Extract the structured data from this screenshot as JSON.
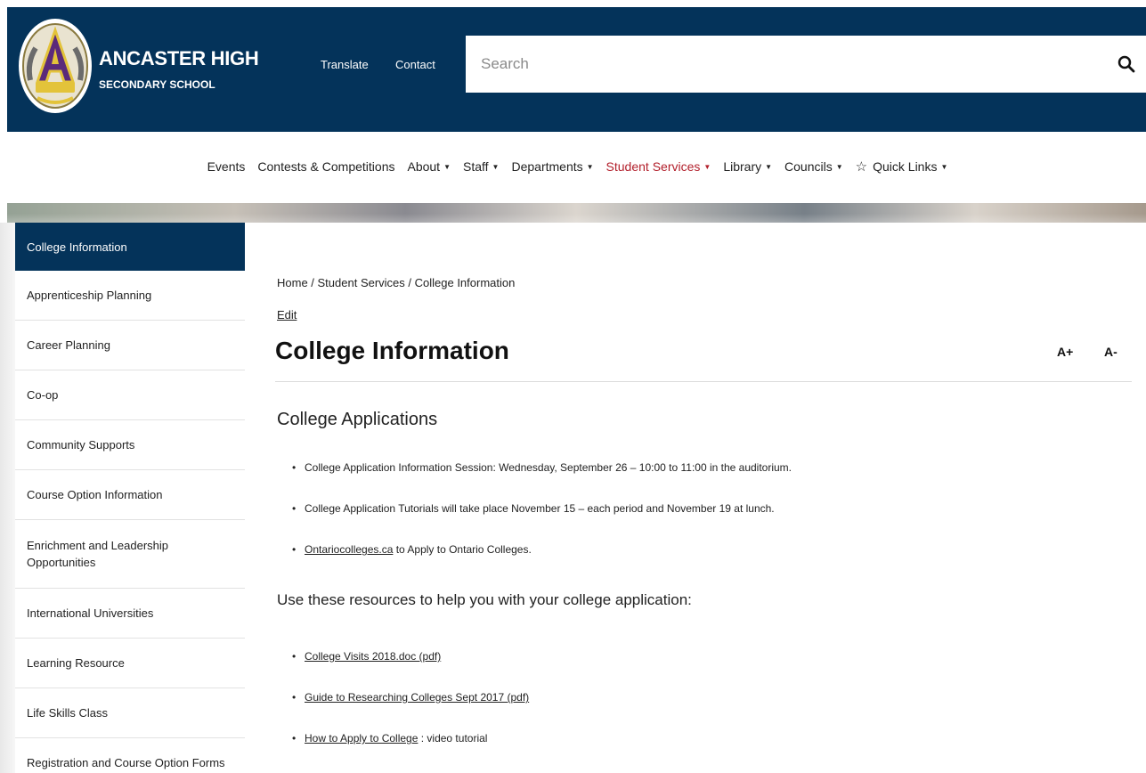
{
  "header": {
    "school_name": "ANCASTER HIGH",
    "school_subtitle": "SECONDARY SCHOOL",
    "translate": "Translate",
    "contact": "Contact",
    "search_placeholder": "Search",
    "bg_color": "#04335a"
  },
  "topnav": {
    "items": [
      {
        "label": "Events",
        "dropdown": false
      },
      {
        "label": "Contests & Competitions",
        "dropdown": false
      },
      {
        "label": "About",
        "dropdown": true
      },
      {
        "label": "Staff",
        "dropdown": true
      },
      {
        "label": "Departments",
        "dropdown": true
      },
      {
        "label": "Student Services",
        "dropdown": true,
        "active": true
      },
      {
        "label": "Library",
        "dropdown": true
      },
      {
        "label": "Councils",
        "dropdown": true
      },
      {
        "label": "Quick Links",
        "dropdown": true,
        "icon": "star-icon"
      }
    ],
    "active_color": "#b21f2b"
  },
  "sidebar": {
    "items": [
      {
        "label": "College Information",
        "active": true
      },
      {
        "label": "Apprenticeship Planning"
      },
      {
        "label": "Career Planning"
      },
      {
        "label": "Co-op"
      },
      {
        "label": "Community Supports"
      },
      {
        "label": "Course Option Information"
      },
      {
        "label": "Enrichment and Leadership Opportunities"
      },
      {
        "label": "International Universities"
      },
      {
        "label": "Learning Resource"
      },
      {
        "label": "Life Skills Class"
      },
      {
        "label": "Registration and Course Option Forms"
      }
    ]
  },
  "main": {
    "breadcrumb": "Home / Student Services / College Information",
    "edit": "Edit",
    "title": "College Information",
    "font_increase": "A+",
    "font_decrease": "A-",
    "section_title": "College Applications",
    "applications": [
      {
        "text": "College Application Information Session:  Wednesday, September 26 – 10:00 to 11:00 in the auditorium."
      },
      {
        "text": "College Application Tutorials will take place November 15 – each period and November 19 at lunch."
      },
      {
        "link": "Ontariocolleges.ca",
        "text": " to Apply to Ontario Colleges."
      }
    ],
    "resources_lead": "Use these resources to help you with your college application:",
    "resources": [
      {
        "link": "College Visits 2018.doc (pdf)",
        "text": ""
      },
      {
        "link": "Guide to Researching Colleges Sept 2017 (pdf)",
        "text": ""
      },
      {
        "link": "How to Apply to College",
        "text": " : video tutorial"
      }
    ]
  }
}
